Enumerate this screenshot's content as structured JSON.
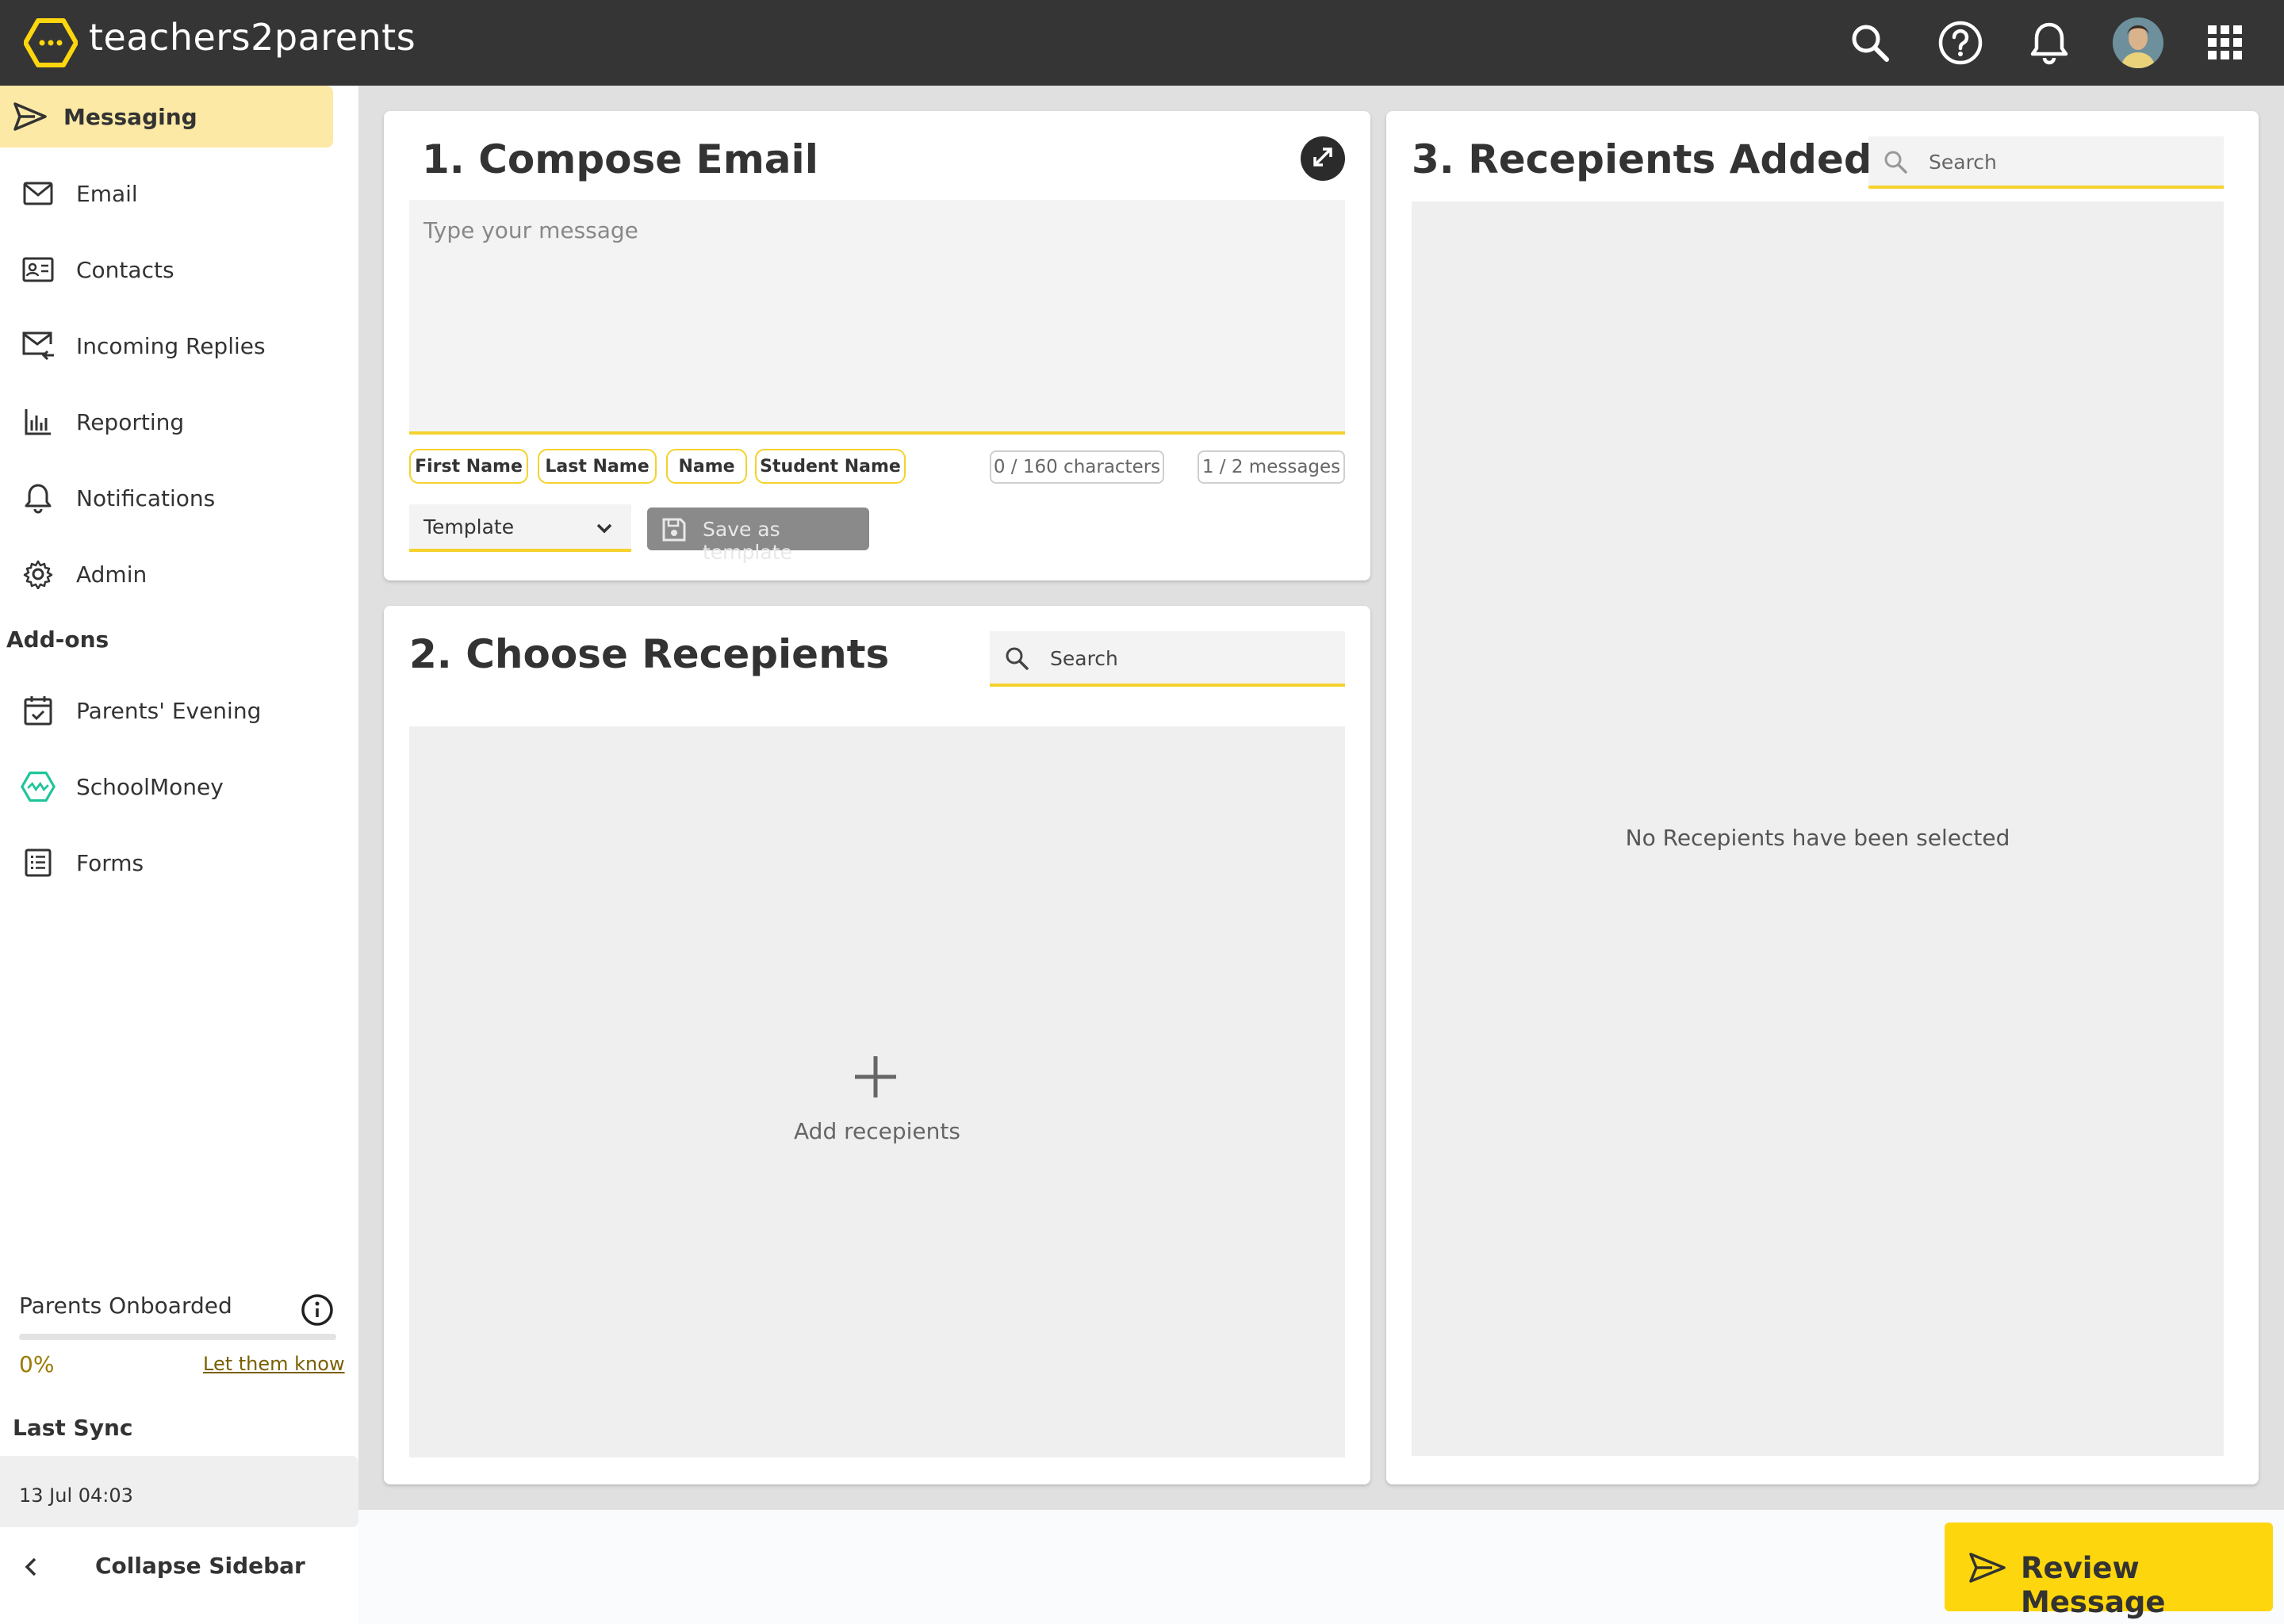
{
  "app": {
    "brand": "teachers2parents"
  },
  "sidebar": {
    "items": [
      {
        "label": "Messaging",
        "icon": "send-icon"
      },
      {
        "label": "Email",
        "icon": "mail-icon"
      },
      {
        "label": "Contacts",
        "icon": "contact-card-icon"
      },
      {
        "label": "Incoming Replies",
        "icon": "mail-reply-icon"
      },
      {
        "label": "Reporting",
        "icon": "bar-chart-icon"
      },
      {
        "label": "Notifications",
        "icon": "bell-icon"
      },
      {
        "label": "Admin",
        "icon": "gear-icon"
      }
    ],
    "addons_heading": "Add-ons",
    "addons": [
      {
        "label": "Parents' Evening",
        "icon": "calendar-check-icon"
      },
      {
        "label": "SchoolMoney",
        "icon": "schoolmoney-icon"
      },
      {
        "label": "Forms",
        "icon": "form-list-icon"
      }
    ],
    "onboarded": {
      "title": "Parents Onboarded",
      "percent": "0%",
      "progress": 0,
      "link": "Let them know"
    },
    "last_sync": {
      "title": "Last Sync",
      "value": "13 Jul 04:03"
    },
    "collapse_label": "Collapse Sidebar"
  },
  "compose": {
    "title": "1. Compose Email",
    "placeholder": "Type your message",
    "chips": [
      "First Name",
      "Last Name",
      "Name",
      "Student Name"
    ],
    "char_count": "0 / 160 characters",
    "msg_count": "1 / 2 messages",
    "template_label": "Template",
    "save_template_label": "Save as template"
  },
  "choose": {
    "title": "2. Choose Recepients",
    "search_placeholder": "Search",
    "add_label": "Add recepients"
  },
  "added": {
    "title": "3. Recepients Added",
    "search_placeholder": "Search",
    "empty_text": "No Recepients have been selected"
  },
  "footer": {
    "review_label": "Review Message"
  },
  "colors": {
    "accent": "#fed60d",
    "topbar": "#353535",
    "active_bg": "#fde9a6",
    "schoolmoney": "#1fc49a"
  }
}
